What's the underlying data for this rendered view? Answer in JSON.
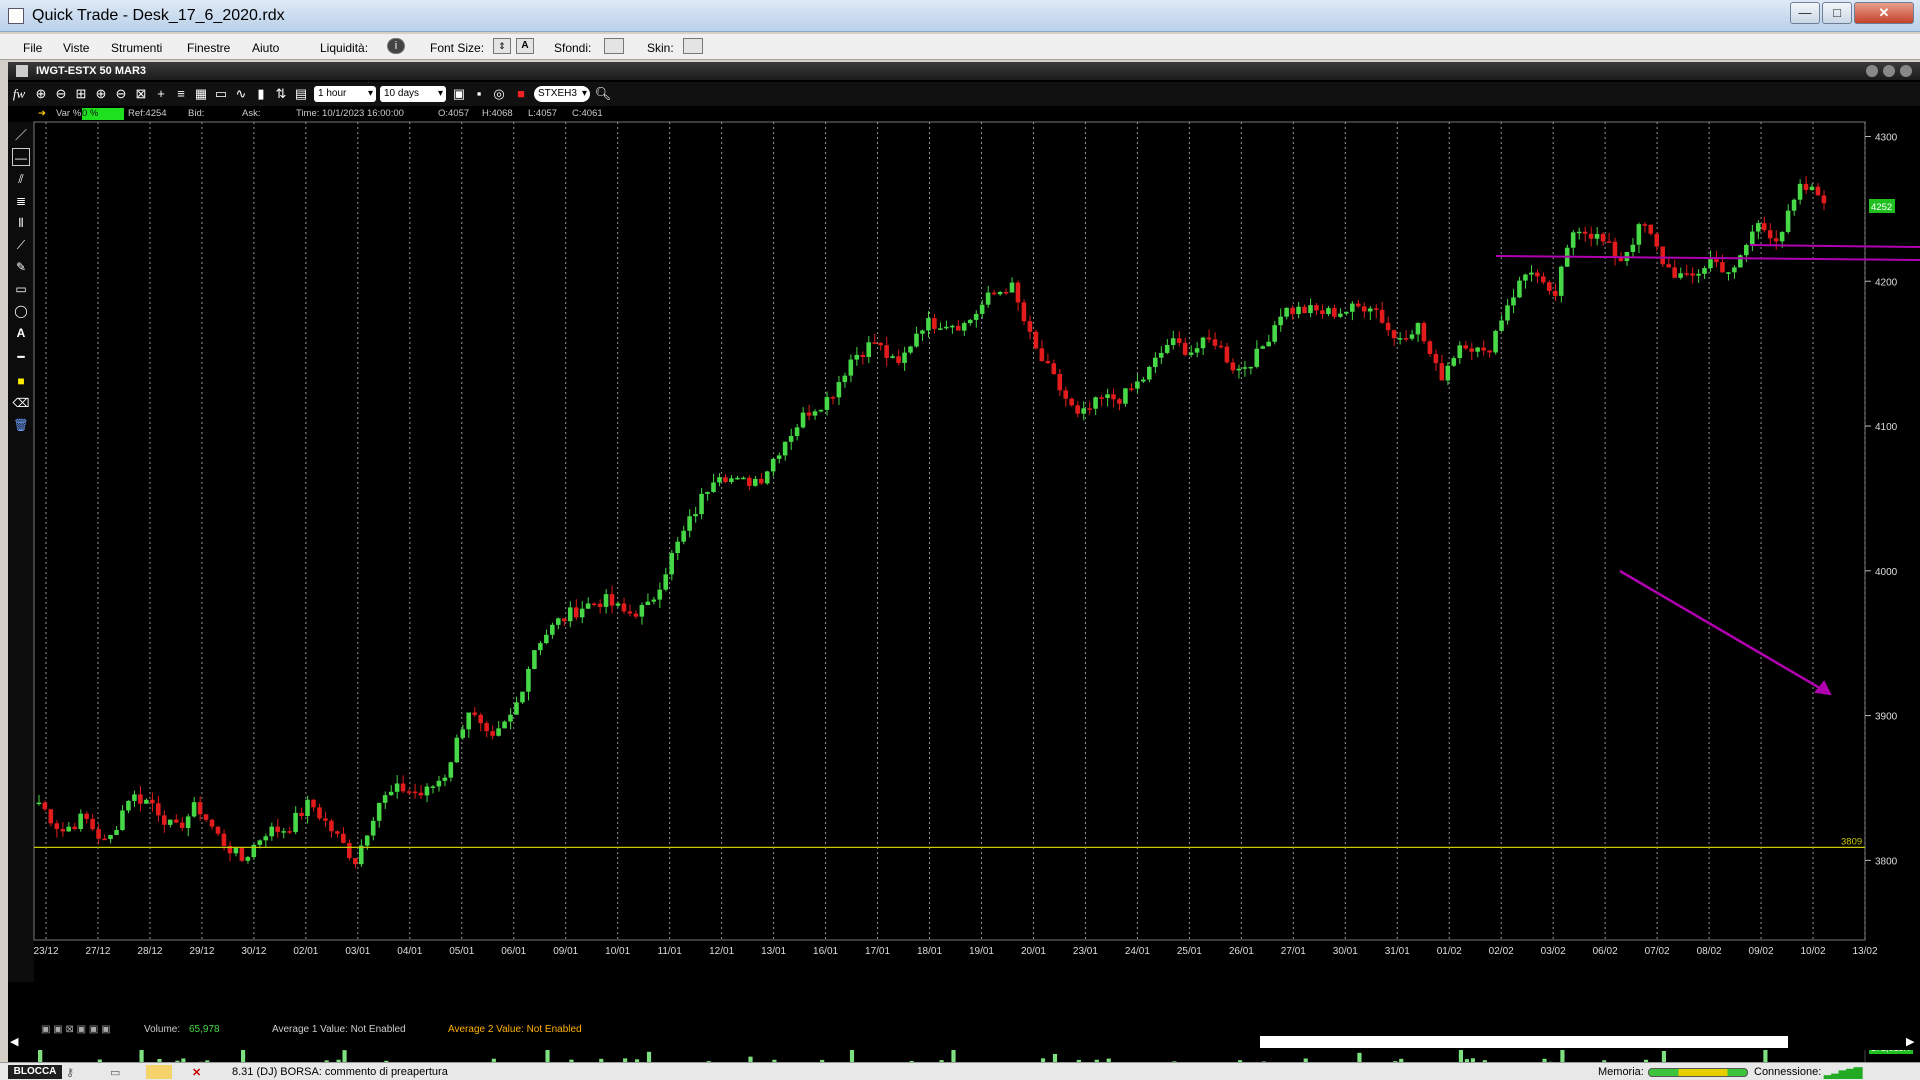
{
  "window": {
    "title": "Quick Trade - Desk_17_6_2020.rdx",
    "minimize": "—",
    "maximize": "□",
    "close": "✕"
  },
  "menu": {
    "items": [
      "File",
      "Viste",
      "Strumenti",
      "Finestre",
      "Aiuto"
    ],
    "liquidita_label": "Liquidità:",
    "font_size_label": "Font Size:",
    "sfondi_label": "Sfondi:",
    "skin_label": "Skin:"
  },
  "chart_window": {
    "title": "IWGT-ESTX 50 MAR3",
    "interval": "1 hour",
    "period": "10 days",
    "symbol": "STXEH3"
  },
  "info": {
    "var_label": "Var %",
    "var_value": "0 %",
    "ref": "Ref:4254",
    "bid": "Bid:",
    "ask": "Ask:",
    "time": "Time:  10/1/2023 16:00:00",
    "open": "O:4057",
    "high": "H:4068",
    "low": "L:4057",
    "close": "C:4061"
  },
  "volume_info": {
    "volume_label": "Volume:",
    "volume_value": "65,978",
    "avg1": "Average 1 Value:  Not Enabled",
    "avg2": "Average 2 Value:  Not Enabled",
    "scale_top": "172,613K",
    "scale_mid": "100K"
  },
  "colors": {
    "up": "#46d846",
    "down": "#e21c1c",
    "hline": "#c8c800",
    "purple": "#b000b0",
    "price_tag": "#21c021"
  },
  "chart_data": {
    "type": "candlestick",
    "instrument": "IWGT-ESTX 50 MAR3",
    "ylim": [
      3745,
      4310
    ],
    "y_ticks": [
      3800,
      3900,
      4000,
      4100,
      4200,
      4300
    ],
    "x_labels": [
      "23/12",
      "27/12",
      "28/12",
      "29/12",
      "30/12",
      "02/01",
      "03/01",
      "04/01",
      "05/01",
      "06/01",
      "09/01",
      "10/01",
      "11/01",
      "12/01",
      "13/01",
      "16/01",
      "17/01",
      "18/01",
      "19/01",
      "20/01",
      "23/01",
      "24/01",
      "25/01",
      "26/01",
      "27/01",
      "30/01",
      "31/01",
      "01/02",
      "02/02",
      "03/02",
      "06/02",
      "07/02",
      "08/02",
      "09/02",
      "10/02",
      "13/02"
    ],
    "last_price": "4252",
    "horizontal_line": {
      "value": 3809,
      "label": "3809"
    },
    "close_path": [
      3840,
      3820,
      3830,
      3810,
      3845,
      3840,
      3820,
      3838,
      3815,
      3800,
      3820,
      3822,
      3840,
      3820,
      3800,
      3840,
      3850,
      3845,
      3860,
      3905,
      3880,
      3902,
      3950,
      3965,
      3975,
      3980,
      3970,
      3975,
      4010,
      4040,
      4070,
      4060,
      4065,
      4090,
      4110,
      4120,
      4148,
      4158,
      4140,
      4170,
      4172,
      4170,
      4188,
      4198,
      4155,
      4130,
      4105,
      4118,
      4120,
      4135,
      4158,
      4152,
      4160,
      4138,
      4150,
      4180,
      4180,
      4178,
      4180,
      4185,
      4160,
      4170,
      4133,
      4160,
      4148,
      4185,
      4210,
      4185,
      4240,
      4230,
      4215,
      4240,
      4210,
      4200,
      4215,
      4205,
      4240,
      4230,
      4265,
      4258
    ]
  }
}
